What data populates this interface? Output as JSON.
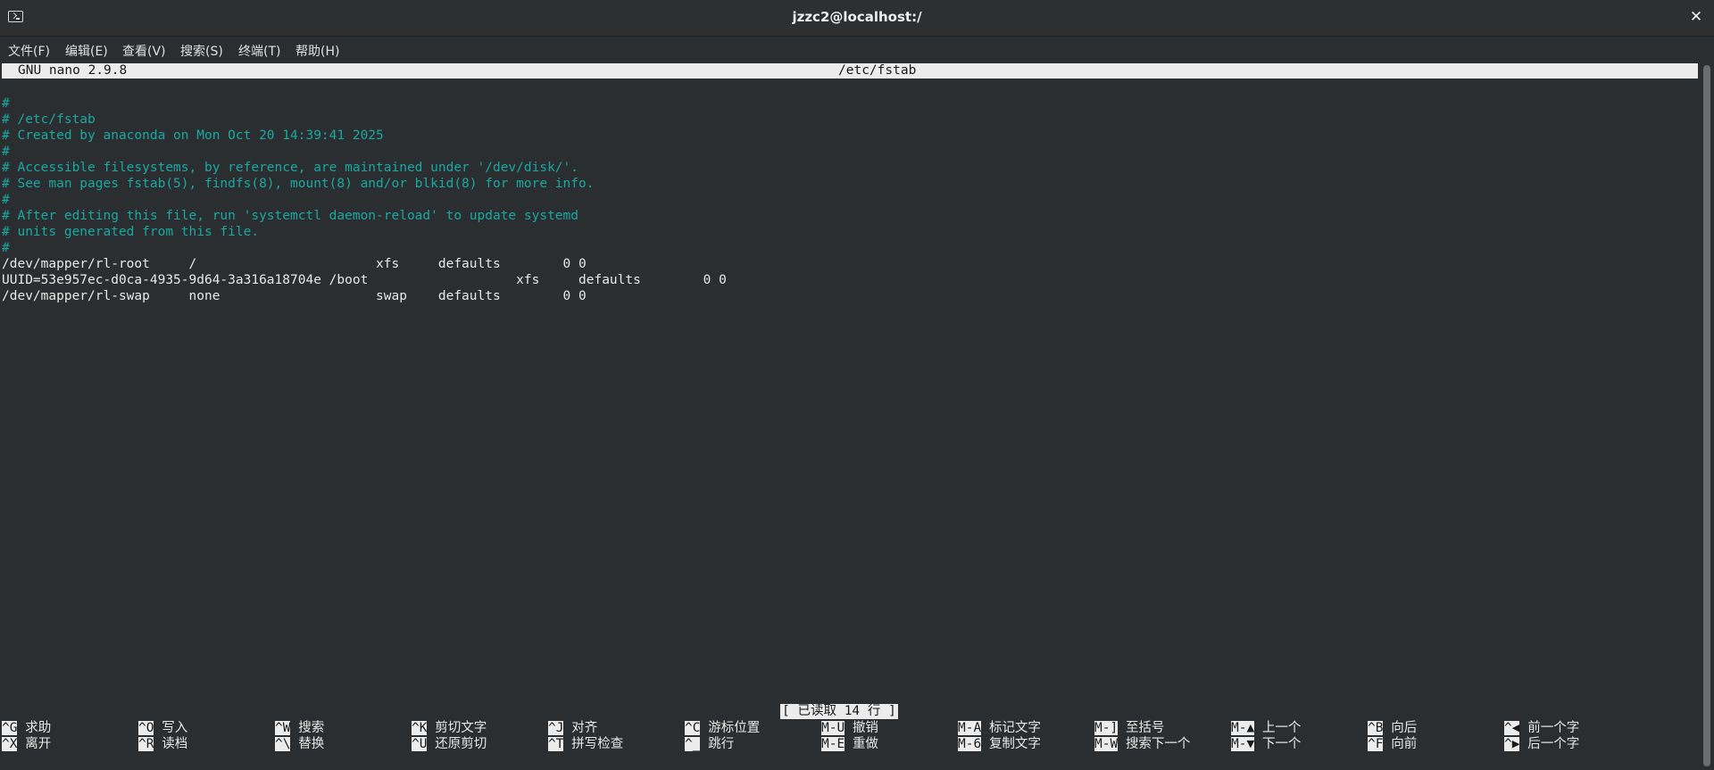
{
  "window": {
    "title": "jzzc2@localhost:/",
    "close_glyph": "✕"
  },
  "menu": [
    "文件(F)",
    "编辑(E)",
    "查看(V)",
    "搜索(S)",
    "终端(T)",
    "帮助(H)"
  ],
  "nano": {
    "version": "GNU nano 2.9.8",
    "filename": "/etc/fstab"
  },
  "file_lines": [
    {
      "text": "",
      "comment": false
    },
    {
      "text": "#",
      "comment": true
    },
    {
      "text": "# /etc/fstab",
      "comment": true
    },
    {
      "text": "# Created by anaconda on Mon Oct 20 14:39:41 2025",
      "comment": true
    },
    {
      "text": "#",
      "comment": true
    },
    {
      "text": "# Accessible filesystems, by reference, are maintained under '/dev/disk/'.",
      "comment": true
    },
    {
      "text": "# See man pages fstab(5), findfs(8), mount(8) and/or blkid(8) for more info.",
      "comment": true
    },
    {
      "text": "#",
      "comment": true
    },
    {
      "text": "# After editing this file, run 'systemctl daemon-reload' to update systemd",
      "comment": true
    },
    {
      "text": "# units generated from this file.",
      "comment": true
    },
    {
      "text": "#",
      "comment": true
    },
    {
      "text": "/dev/mapper/rl-root     /                       xfs     defaults        0 0",
      "comment": false
    },
    {
      "text": "UUID=53e957ec-d0ca-4935-9d64-3a316a18704e /boot                   xfs     defaults        0 0",
      "comment": false
    },
    {
      "text": "/dev/mapper/rl-swap     none                    swap    defaults        0 0",
      "comment": false
    }
  ],
  "status_message": "[ 已读取 14 行 ]",
  "shortcuts_row1": [
    {
      "key": "^G",
      "label": "求助"
    },
    {
      "key": "^O",
      "label": "写入"
    },
    {
      "key": "^W",
      "label": "搜索"
    },
    {
      "key": "^K",
      "label": "剪切文字"
    },
    {
      "key": "^J",
      "label": "对齐"
    },
    {
      "key": "^C",
      "label": "游标位置"
    },
    {
      "key": "M-U",
      "label": "撤销"
    },
    {
      "key": "M-A",
      "label": "标记文字"
    },
    {
      "key": "M-]",
      "label": "至括号"
    },
    {
      "key": "M-▲",
      "label": "上一个"
    },
    {
      "key": "^B",
      "label": "向后"
    },
    {
      "key": "^◀",
      "label": "前一个字"
    }
  ],
  "shortcuts_row2": [
    {
      "key": "^X",
      "label": "离开"
    },
    {
      "key": "^R",
      "label": "读档"
    },
    {
      "key": "^\\",
      "label": "替换"
    },
    {
      "key": "^U",
      "label": "还原剪切"
    },
    {
      "key": "^T",
      "label": "拼写检查"
    },
    {
      "key": "^_",
      "label": "跳行"
    },
    {
      "key": "M-E",
      "label": "重做"
    },
    {
      "key": "M-6",
      "label": "复制文字"
    },
    {
      "key": "M-W",
      "label": "搜索下一个"
    },
    {
      "key": "M-▼",
      "label": "下一个"
    },
    {
      "key": "^F",
      "label": "向前"
    },
    {
      "key": "^▶",
      "label": "后一个字"
    }
  ],
  "colors": {
    "background": "#2b2e30",
    "comment": "#1aa8a2",
    "header_bg": "#ececec",
    "text": "#e8e8e8"
  }
}
